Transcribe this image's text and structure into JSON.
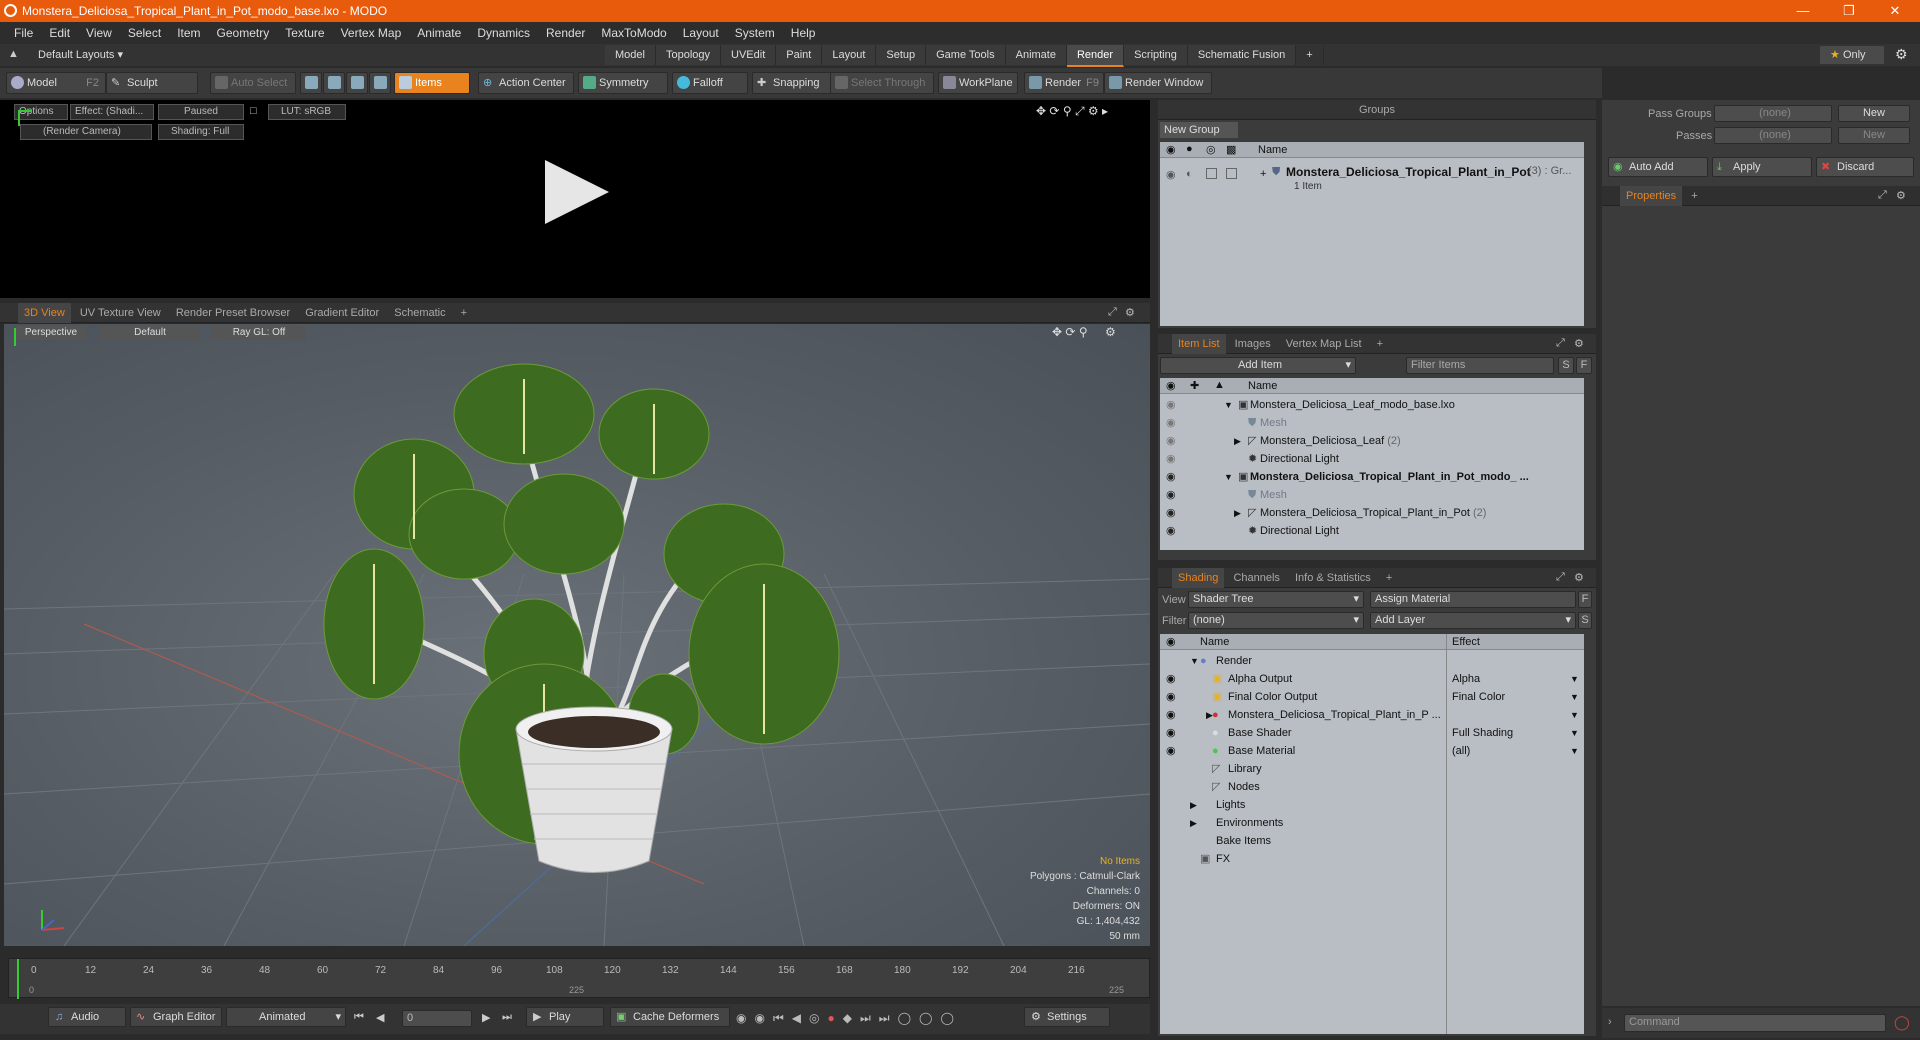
{
  "window": {
    "title": "Monstera_Deliciosa_Tropical_Plant_in_Pot_modo_base.lxo - MODO"
  },
  "menu": [
    "File",
    "Edit",
    "View",
    "Select",
    "Item",
    "Geometry",
    "Texture",
    "Vertex Map",
    "Animate",
    "Dynamics",
    "Render",
    "MaxToModo",
    "Layout",
    "System",
    "Help"
  ],
  "layouts": {
    "selector": "Default Layouts",
    "tabs": [
      "Model",
      "Topology",
      "UVEdit",
      "Paint",
      "Layout",
      "Setup",
      "Game Tools",
      "Animate",
      "Render",
      "Scripting",
      "Schematic Fusion"
    ],
    "active": "Render",
    "only": "Only"
  },
  "toolbar": {
    "model": "Model",
    "model_key": "F2",
    "sculpt": "Sculpt",
    "auto_select": "Auto Select",
    "items": "Items",
    "action_center": "Action Center",
    "symmetry": "Symmetry",
    "falloff": "Falloff",
    "snapping": "Snapping",
    "select_through": "Select Through",
    "workplane": "WorkPlane",
    "render": "Render",
    "render_key": "F9",
    "render_window": "Render Window"
  },
  "render_preview": {
    "options": "Options",
    "effect": "Effect: (Shadi...",
    "paused": "Paused",
    "lut": "LUT: sRGB",
    "camera": "(Render Camera)",
    "shading": "Shading: Full"
  },
  "viewport_tabs": [
    "3D View",
    "UV Texture View",
    "Render Preset Browser",
    "Gradient Editor",
    "Schematic"
  ],
  "viewport": {
    "perspective": "Perspective",
    "default": "Default",
    "raygl": "Ray GL: Off",
    "info": {
      "no_items": "No Items",
      "polygons": "Polygons : Catmull-Clark",
      "channels": "Channels: 0",
      "deformers": "Deformers: ON",
      "gl": "GL: 1,404,432",
      "units": "50 mm"
    }
  },
  "timeline": {
    "ticks": [
      "0",
      "12",
      "24",
      "36",
      "48",
      "60",
      "72",
      "84",
      "96",
      "108",
      "120",
      "132",
      "144",
      "156",
      "168",
      "180",
      "192",
      "204",
      "216"
    ],
    "sub_ticks": [
      "0",
      "225",
      "225"
    ]
  },
  "bottom": {
    "audio": "Audio",
    "graph_editor": "Graph Editor",
    "animated": "Animated",
    "frame": "0",
    "play": "Play",
    "cache": "Cache Deformers",
    "settings": "Settings",
    "command": "Command"
  },
  "groups": {
    "title": "Groups",
    "new_group": "New Group",
    "col_name": "Name",
    "item_name": "Monstera_Deliciosa_Tropical_Plant_in_Pot",
    "item_suffix": "(3) : Gr...",
    "item_count": "1 Item"
  },
  "pass": {
    "pass_groups": "Pass Groups",
    "passes": "Passes",
    "none": "(none)",
    "new": "New",
    "auto_add": "Auto Add",
    "apply": "Apply",
    "discard": "Discard",
    "properties": "Properties"
  },
  "itemlist": {
    "tabs": [
      "Item List",
      "Images",
      "Vertex Map List"
    ],
    "add_item": "Add Item",
    "filter": "Filter Items",
    "s": "S",
    "f": "F",
    "col_name": "Name",
    "rows": [
      {
        "text": "Monstera_Deliciosa_Leaf_modo_base.lxo",
        "indent": 0,
        "bold": false,
        "dim": false
      },
      {
        "text": "Mesh",
        "indent": 1,
        "bold": false,
        "dim": true
      },
      {
        "text": "Monstera_Deliciosa_Leaf",
        "suffix": "(2)",
        "indent": 1,
        "bold": false,
        "dim": false
      },
      {
        "text": "Directional Light",
        "indent": 1,
        "bold": false,
        "dim": false
      },
      {
        "text": "Monstera_Deliciosa_Tropical_Plant_in_Pot_modo_ ...",
        "indent": 0,
        "bold": true,
        "dim": false
      },
      {
        "text": "Mesh",
        "indent": 1,
        "bold": false,
        "dim": true
      },
      {
        "text": "Monstera_Deliciosa_Tropical_Plant_in_Pot",
        "suffix": "(2)",
        "indent": 1,
        "bold": false,
        "dim": false
      },
      {
        "text": "Directional Light",
        "indent": 1,
        "bold": false,
        "dim": false
      }
    ]
  },
  "shading": {
    "tabs": [
      "Shading",
      "Channels",
      "Info & Statistics"
    ],
    "view_label": "View",
    "view": "Shader Tree",
    "assign": "Assign Material",
    "filter_label": "Filter",
    "filter": "(none)",
    "add_layer": "Add Layer",
    "col_name": "Name",
    "col_effect": "Effect",
    "rows": [
      {
        "name": "Render",
        "effect": ""
      },
      {
        "name": "Alpha Output",
        "effect": "Alpha"
      },
      {
        "name": "Final Color Output",
        "effect": "Final Color"
      },
      {
        "name": "Monstera_Deliciosa_Tropical_Plant_in_P ...",
        "effect": ""
      },
      {
        "name": "Base Shader",
        "effect": "Full Shading"
      },
      {
        "name": "Base Material",
        "effect": "(all)"
      },
      {
        "name": "Library",
        "effect": ""
      },
      {
        "name": "Nodes",
        "effect": ""
      },
      {
        "name": "Lights",
        "effect": ""
      },
      {
        "name": "Environments",
        "effect": ""
      },
      {
        "name": "Bake Items",
        "effect": ""
      },
      {
        "name": "FX",
        "effect": ""
      }
    ]
  }
}
